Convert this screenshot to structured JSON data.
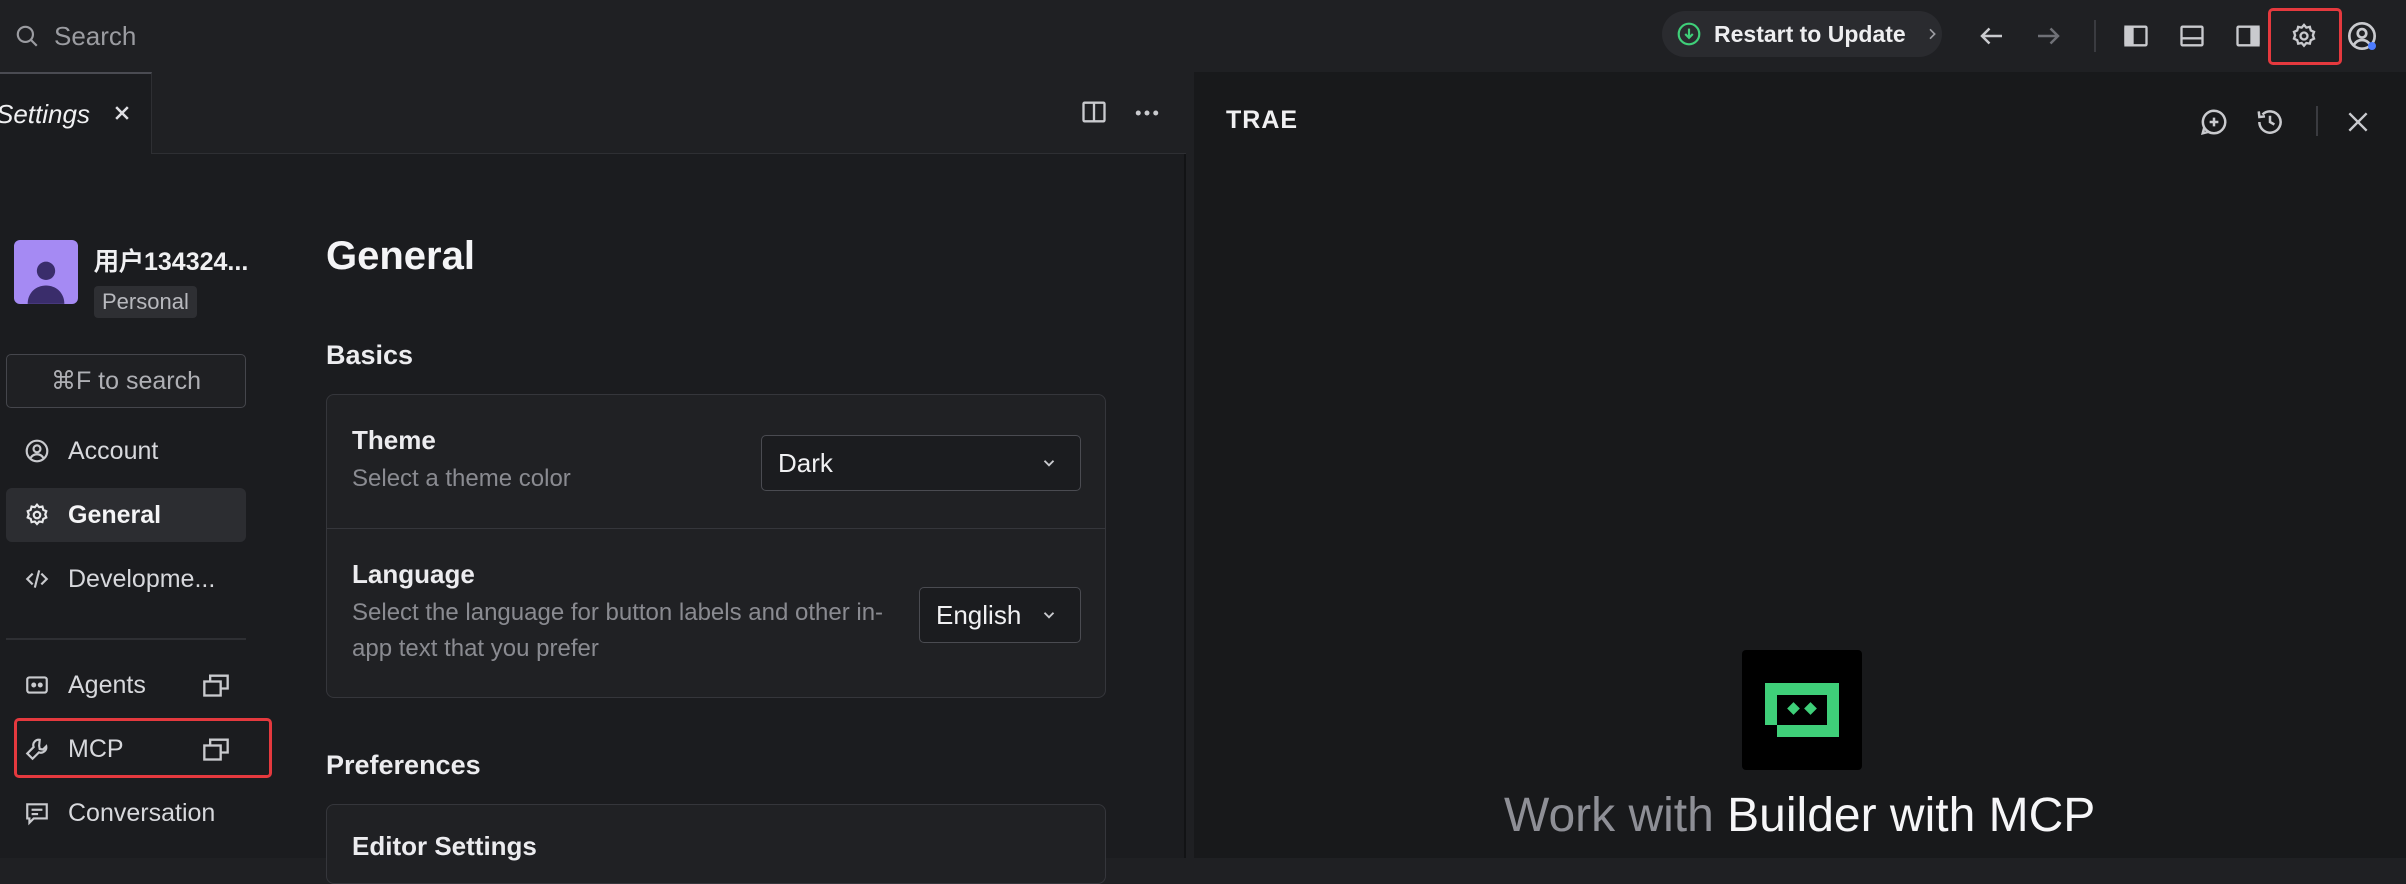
{
  "topbar": {
    "search_placeholder": "Search",
    "update_label": "Restart to Update"
  },
  "tab": {
    "label": "Settings"
  },
  "user": {
    "name": "用户134324...",
    "badge": "Personal"
  },
  "nav": {
    "search_label": "⌘F to search",
    "items": [
      {
        "label": "Account"
      },
      {
        "label": "General"
      },
      {
        "label": "Developme..."
      },
      {
        "label": "Agents"
      },
      {
        "label": "MCP"
      },
      {
        "label": "Conversation"
      }
    ]
  },
  "content": {
    "title": "General",
    "basics": {
      "title": "Basics",
      "theme": {
        "label": "Theme",
        "desc": "Select a theme color",
        "value": "Dark"
      },
      "language": {
        "label": "Language",
        "desc": "Select the language for button labels and other in-app text that you prefer",
        "value": "English"
      }
    },
    "preferences": {
      "title": "Preferences",
      "editor_settings": "Editor Settings"
    }
  },
  "right_panel": {
    "title": "TRAE",
    "hero_muted": "Work with",
    "hero_strong": "Builder with MCP"
  },
  "colors": {
    "accent_red": "#e5393e",
    "logo_green": "#3fcf79",
    "avatar_purple": "#a58af3",
    "status_blue": "#4d7cff"
  }
}
